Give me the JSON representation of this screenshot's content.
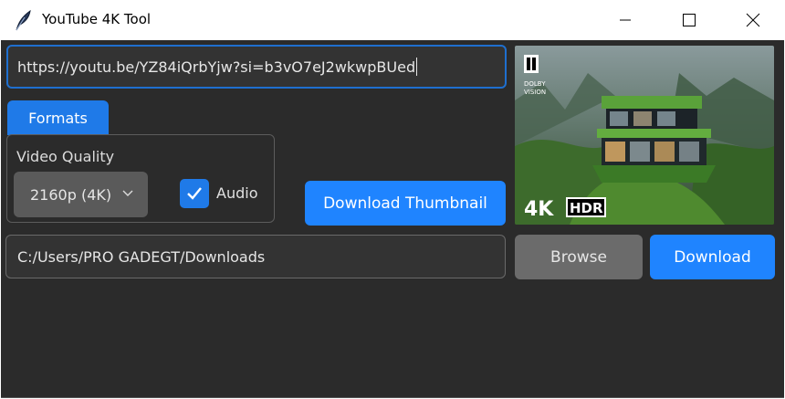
{
  "window": {
    "title": "YouTube 4K Tool",
    "icon": "feather-icon",
    "controls": [
      "minimize-icon",
      "maximize-icon",
      "close-icon"
    ]
  },
  "url": {
    "value": "https://youtu.be/YZ84iQrbYjw?si=b3vO7eJ2wkwpBUed"
  },
  "tabs": [
    {
      "label": "Formats",
      "active": true
    }
  ],
  "formats": {
    "quality_label": "Video Quality",
    "quality_selected": "2160p (4K)",
    "audio_label": "Audio",
    "audio_checked": true
  },
  "thumbnail": {
    "badge_top": "DOLBY",
    "badge_bottom": "VISION",
    "badge_res": "4K",
    "badge_hdr": "HDR"
  },
  "buttons": {
    "download_thumbnail": "Download Thumbnail",
    "browse": "Browse",
    "download": "Download"
  },
  "path": {
    "value": "C:/Users/PRO GADEGT/Downloads"
  },
  "colors": {
    "accent": "#1f84ff",
    "background": "#2b2b2b",
    "field": "#333333",
    "neutral_button": "#6b6b6b"
  }
}
